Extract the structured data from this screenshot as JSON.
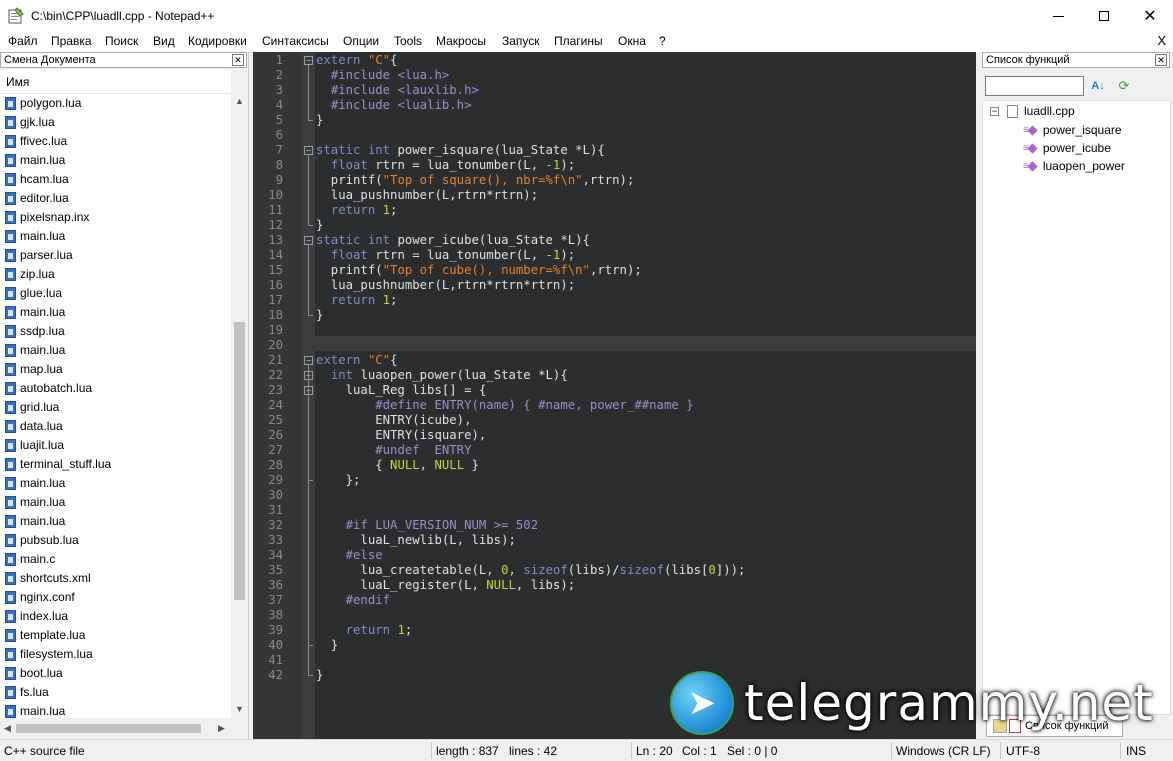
{
  "window": {
    "title": "C:\\bin\\CPP\\luadll.cpp - Notepad++"
  },
  "menu": [
    "Файл",
    "Правка",
    "Поиск",
    "Вид",
    "Кодировки",
    "Синтаксисы",
    "Опции",
    "Tools",
    "Макросы",
    "Запуск",
    "Плагины",
    "Окна",
    "?"
  ],
  "menu_close": "X",
  "left_panel": {
    "title": "Смена Документа",
    "column_header": "Имя",
    "files": [
      "polygon.lua",
      "gjk.lua",
      "ffivec.lua",
      "main.lua",
      "hcam.lua",
      "editor.lua",
      "pixelsnap.inx",
      "main.lua",
      "parser.lua",
      "zip.lua",
      "glue.lua",
      "main.lua",
      "ssdp.lua",
      "main.lua",
      "map.lua",
      "autobatch.lua",
      "grid.lua",
      "data.lua",
      "luajit.lua",
      "terminal_stuff.lua",
      "main.lua",
      "main.lua",
      "main.lua",
      "pubsub.lua",
      "main.c",
      "shortcuts.xml",
      "nginx.conf",
      "index.lua",
      "template.lua",
      "filesystem.lua",
      "boot.lua",
      "fs.lua",
      "main.lua"
    ]
  },
  "editor": {
    "current_line": 21,
    "lines": [
      [
        [
          "kw",
          "extern "
        ],
        [
          "st",
          "\"C\""
        ],
        [
          "",
          "{"
        ]
      ],
      [
        [
          "",
          "  "
        ],
        [
          "pp",
          "#include <lua.h>"
        ]
      ],
      [
        [
          "",
          "  "
        ],
        [
          "pp",
          "#include <lauxlib.h>"
        ]
      ],
      [
        [
          "",
          "  "
        ],
        [
          "pp",
          "#include <lualib.h>"
        ]
      ],
      [
        [
          "",
          "}"
        ]
      ],
      [],
      [
        [
          "kw",
          "static "
        ],
        [
          "ty",
          "int "
        ],
        [
          "",
          "power_isquare(lua_State *L){"
        ]
      ],
      [
        [
          "",
          "  "
        ],
        [
          "ty",
          "float "
        ],
        [
          "",
          "rtrn = lua_tonumber(L, "
        ],
        [
          "nm",
          "-1"
        ],
        [
          "",
          ");"
        ]
      ],
      [
        [
          "",
          "  printf("
        ],
        [
          "st",
          "\"Top of square(), nbr=%f\\n\""
        ],
        [
          "",
          ",rtrn);"
        ]
      ],
      [
        [
          "",
          "  lua_pushnumber(L,rtrn*rtrn);"
        ]
      ],
      [
        [
          "",
          "  "
        ],
        [
          "kw",
          "return "
        ],
        [
          "nm",
          "1"
        ],
        [
          "",
          ";"
        ]
      ],
      [
        [
          "",
          "}"
        ]
      ],
      [
        [
          "kw",
          "static "
        ],
        [
          "ty",
          "int "
        ],
        [
          "",
          "power_icube(lua_State *L){"
        ]
      ],
      [
        [
          "",
          "  "
        ],
        [
          "ty",
          "float "
        ],
        [
          "",
          "rtrn = lua_tonumber(L, "
        ],
        [
          "nm",
          "-1"
        ],
        [
          "",
          ");"
        ]
      ],
      [
        [
          "",
          "  printf("
        ],
        [
          "st",
          "\"Top of cube(), number=%f\\n\""
        ],
        [
          "",
          ",rtrn);"
        ]
      ],
      [
        [
          "",
          "  lua_pushnumber(L,rtrn*rtrn*rtrn);"
        ]
      ],
      [
        [
          "",
          "  "
        ],
        [
          "kw",
          "return "
        ],
        [
          "nm",
          "1"
        ],
        [
          "",
          ";"
        ]
      ],
      [
        [
          "",
          "}"
        ]
      ],
      [],
      [],
      [
        [
          "kw",
          "extern "
        ],
        [
          "st",
          "\"C\""
        ],
        [
          "",
          "{"
        ]
      ],
      [
        [
          "",
          "  "
        ],
        [
          "ty",
          "int "
        ],
        [
          "",
          "luaopen_power(lua_State *L){"
        ]
      ],
      [
        [
          "",
          "    luaL_Reg libs[] = {"
        ]
      ],
      [
        [
          "",
          "        "
        ],
        [
          "pp",
          "#define ENTRY(name) { #name, power_##name }"
        ]
      ],
      [
        [
          "",
          "        ENTRY(icube),"
        ]
      ],
      [
        [
          "",
          "        ENTRY(isquare),"
        ]
      ],
      [
        [
          "",
          "        "
        ],
        [
          "pp",
          "#undef  ENTRY"
        ]
      ],
      [
        [
          "",
          "        { "
        ],
        [
          "cl",
          "NULL"
        ],
        [
          "",
          ", "
        ],
        [
          "cl",
          "NULL"
        ],
        [
          "",
          " }"
        ]
      ],
      [
        [
          "",
          "    };"
        ]
      ],
      [],
      [],
      [
        [
          "",
          "    "
        ],
        [
          "pp",
          "#if LUA_VERSION_NUM >= 502"
        ]
      ],
      [
        [
          "",
          "      luaL_newlib(L, libs);"
        ]
      ],
      [
        [
          "",
          "    "
        ],
        [
          "pp",
          "#else"
        ]
      ],
      [
        [
          "",
          "      lua_createtable(L, "
        ],
        [
          "nm",
          "0"
        ],
        [
          "",
          ", "
        ],
        [
          "kw",
          "sizeof"
        ],
        [
          "",
          "(libs)/"
        ],
        [
          "kw",
          "sizeof"
        ],
        [
          "",
          "(libs["
        ],
        [
          "nm",
          "0"
        ],
        [
          "",
          "]));"
        ]
      ],
      [
        [
          "",
          "      luaL_register(L, "
        ],
        [
          "cl",
          "NULL"
        ],
        [
          "",
          ", libs);"
        ]
      ],
      [
        [
          "",
          "    "
        ],
        [
          "pp",
          "#endif"
        ]
      ],
      [],
      [
        [
          "",
          "    "
        ],
        [
          "kw",
          "return "
        ],
        [
          "nm",
          "1"
        ],
        [
          "",
          ";"
        ]
      ],
      [
        [
          "",
          "  }"
        ]
      ],
      [],
      [
        [
          "",
          "}"
        ]
      ]
    ]
  },
  "right_panel": {
    "title": "Список функций",
    "search_value": "",
    "sort_icon": "sort-az-icon",
    "refresh_icon": "refresh-icon",
    "root": "luadll.cpp",
    "functions": [
      "power_isquare",
      "power_icube",
      "luaopen_power"
    ],
    "tab_label": "Список функций"
  },
  "watermark": {
    "text": "telegrammy.net"
  },
  "status": {
    "file_type": "C++ source file",
    "length": "length : 837",
    "lines": "lines : 42",
    "ln": "Ln : 20",
    "col": "Col : 1",
    "sel": "Sel : 0 | 0",
    "eol": "Windows (CR LF)",
    "encoding": "UTF-8",
    "mode": "INS"
  },
  "colors": {
    "editor_bg": "#2b2d2e",
    "keyword": "#7a8fc4",
    "preprocessor": "#9f8cc9",
    "string": "#e8812c",
    "number": "#c3d63c"
  }
}
